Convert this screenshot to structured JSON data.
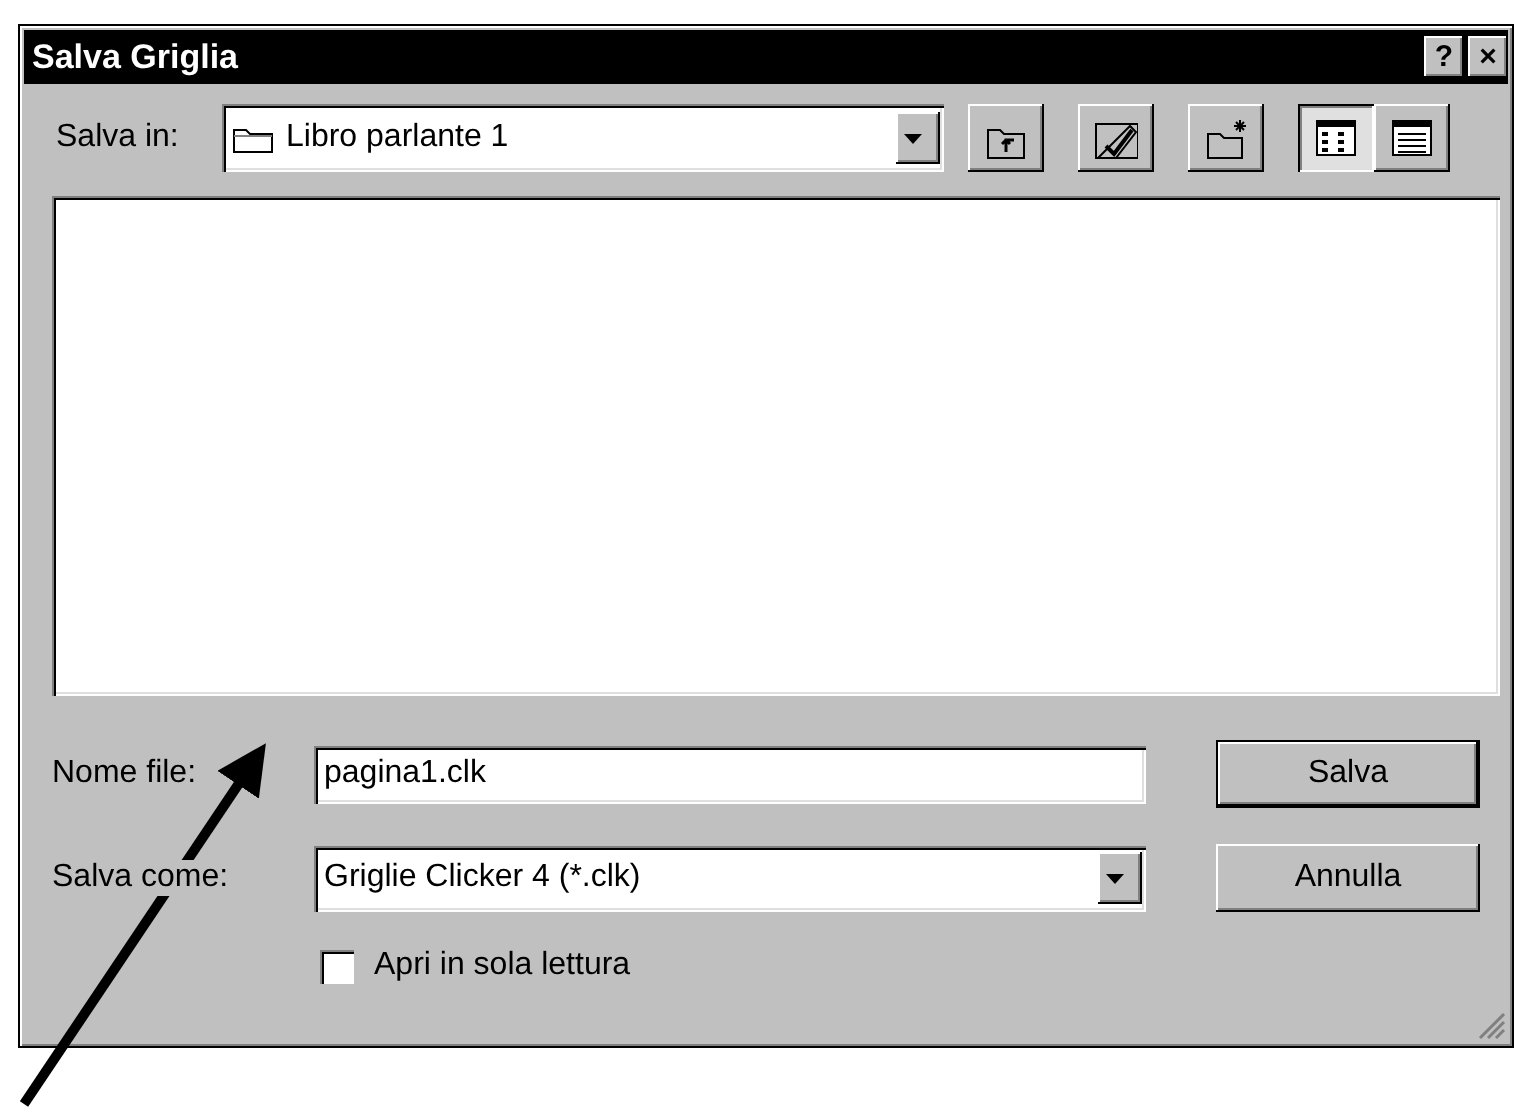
{
  "window": {
    "title": "Salva Griglia",
    "help_button": "?",
    "close_button": "×"
  },
  "location": {
    "label": "Salva in:",
    "value": "Libro parlante 1"
  },
  "toolbar": [
    {
      "kind": "up"
    },
    {
      "kind": "tag"
    },
    {
      "kind": "new-folder"
    }
  ],
  "views": [
    {
      "kind": "list",
      "selected": true
    },
    {
      "kind": "details",
      "selected": false
    }
  ],
  "file_name": {
    "label": "Nome file:",
    "value": "pagina1.clk"
  },
  "file_type": {
    "label": "Salva come:",
    "value": "Griglie Clicker 4 (*.clk)"
  },
  "read_only": {
    "label": "Apri in sola lettura",
    "checked": false
  },
  "buttons": [
    {
      "label": "Salva",
      "default": true
    },
    {
      "label": "Annulla",
      "default": false
    }
  ]
}
